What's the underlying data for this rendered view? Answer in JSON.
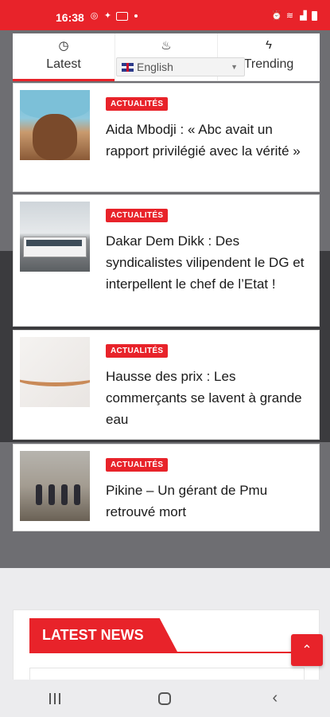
{
  "status_bar": {
    "time": "16:38",
    "left_icons": [
      "whatsapp-icon",
      "twitter-icon",
      "news-app-icon",
      "dot-icon"
    ],
    "right_icons": [
      "alarm-icon",
      "wifi-icon",
      "signal-icon",
      "battery-icon"
    ]
  },
  "tabs": [
    {
      "label": "Latest",
      "icon": "clock-icon",
      "active": true
    },
    {
      "label": "",
      "icon": "fire-icon",
      "active": false
    },
    {
      "label": "Trending",
      "icon": "bolt-icon",
      "active": false
    }
  ],
  "language_select": {
    "value": "English",
    "icon": "uk-flag-icon"
  },
  "articles": [
    {
      "category": "ACTUALITÉS",
      "title": "Aida Mbodji : « Abc avait un rapport privilégié avec la vérité »"
    },
    {
      "category": "ACTUALITÉS",
      "title": "Dakar Dem Dikk : Des syndicalistes vilipendent le DG et interpellent le chef de l’Etat !"
    },
    {
      "category": "ACTUALITÉS",
      "title": "Hausse des prix : Les commerçants se lavent à grande eau"
    },
    {
      "category": "ACTUALITÉS",
      "title": "Pikine – Un gérant de Pmu retrouvé mort"
    }
  ],
  "latest_news": {
    "title": "LATEST NEWS"
  },
  "scroll_top": {
    "icon": "chevron-up-icon"
  },
  "colors": {
    "accent": "#e8232a"
  }
}
